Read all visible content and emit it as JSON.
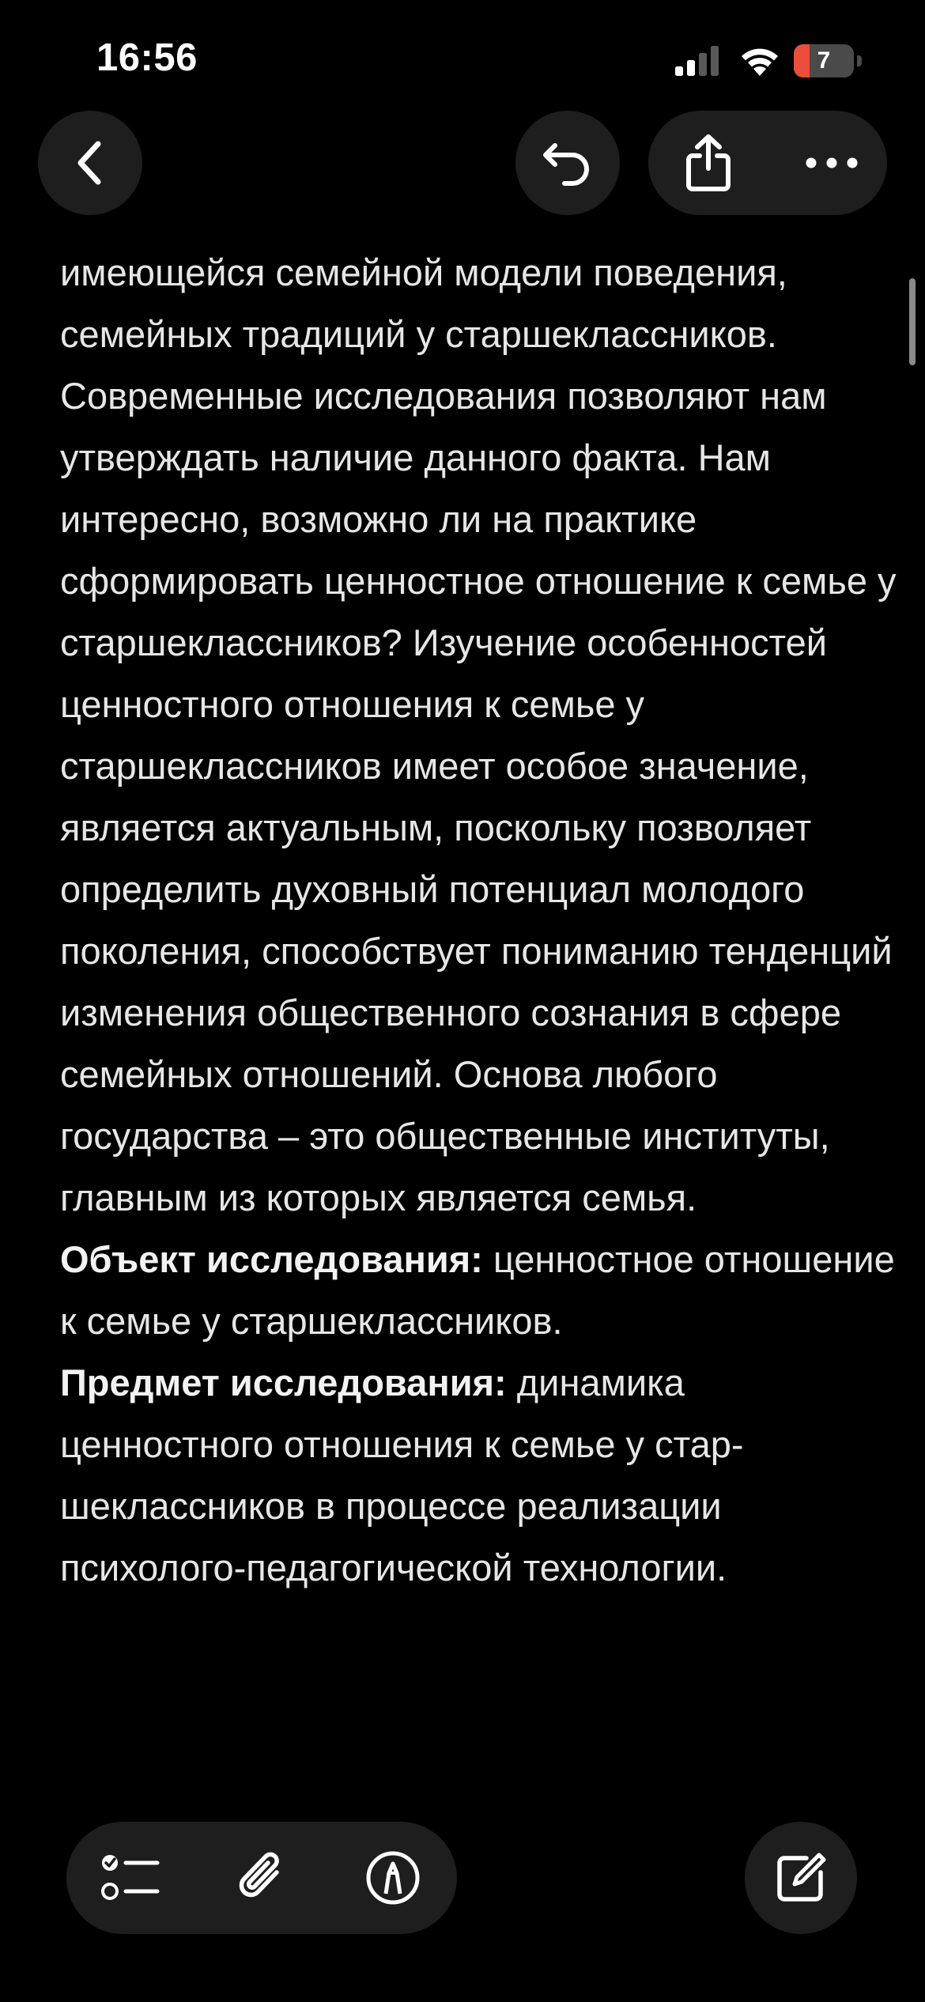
{
  "status_bar": {
    "time": "16:56",
    "battery_level": "7",
    "battery_color": "#eb4e3d",
    "signal_bars_active": 2,
    "signal_bars_total": 4
  },
  "nav": {
    "back_icon": "chevron-left-icon",
    "undo_icon": "undo-icon",
    "share_icon": "share-icon",
    "more_icon": "ellipsis-icon"
  },
  "note": {
    "paragraph_1": "имеющейся семейной модели поведения, семейных традиций у старшеклассников. Современные исследования позволяют нам утверждать наличие данного факта. Нам интересно, возможно ли на практике сформировать ценностное отношение к семье у старшеклассников? Изучение особенностей ценностного отношения к семье у старшеклассников имеет особое значение, является актуальным, поскольку позволяет определить духовный потенциал молодого поколения, способствует пониманию тенденций изменения общественного сознания в сфере семейных отношений. Основа любого государства – это общественные институты, главным из которых является семья.",
    "object_label": "Объект исследования:",
    "object_text": " ценностное отношение к семье у старшеклассников.",
    "subject_label": "Предмет исследования:",
    "subject_text": " динамика ценностного отношения к семье у стар-шеклассников в процессе реализации психолого-педагогической технологии."
  },
  "toolbar": {
    "checklist_icon": "checklist-icon",
    "attachment_icon": "paperclip-icon",
    "markup_icon": "pen-markup-icon",
    "compose_icon": "compose-icon"
  }
}
